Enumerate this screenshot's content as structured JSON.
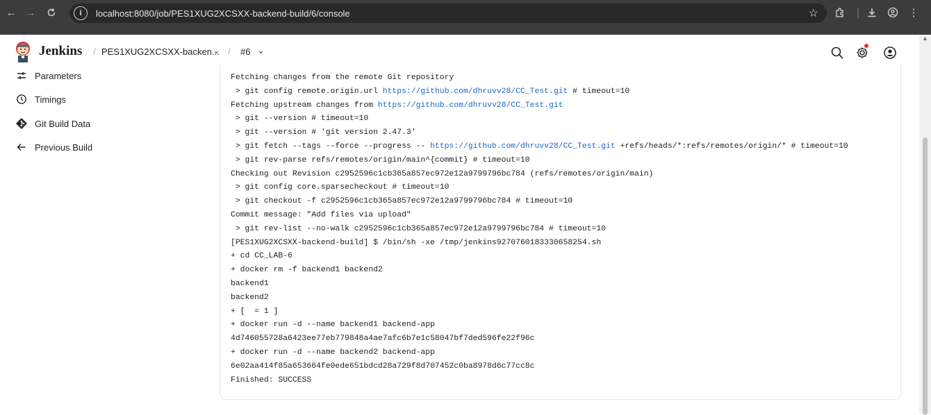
{
  "browser": {
    "url": "localhost:8080/job/PES1XUG2XCSXX-backend-build/6/console"
  },
  "header": {
    "brand": "Jenkins",
    "breadcrumb_job": "PES1XUG2XCSXX-backen...",
    "breadcrumb_build": "#6"
  },
  "sidebar": {
    "items": [
      {
        "label": "Parameters",
        "icon": "sliders-icon"
      },
      {
        "label": "Timings",
        "icon": "clock-icon"
      },
      {
        "label": "Git Build Data",
        "icon": "git-icon"
      },
      {
        "label": "Previous Build",
        "icon": "arrow-left-icon"
      }
    ]
  },
  "console": {
    "lines": [
      {
        "text": "Fetching changes from the remote Git repository"
      },
      {
        "pre": " > git config remote.origin.url ",
        "link": "https://github.com/dhruvv28/CC_Test.git",
        "post": " # timeout=10"
      },
      {
        "pre": "Fetching upstream changes from ",
        "link": "https://github.com/dhruvv28/CC_Test.git",
        "post": ""
      },
      {
        "text": " > git --version # timeout=10"
      },
      {
        "text": " > git --version # 'git version 2.47.3'"
      },
      {
        "pre": " > git fetch --tags --force --progress -- ",
        "link": "https://github.com/dhruvv28/CC_Test.git",
        "post": " +refs/heads/*:refs/remotes/origin/* # timeout=10"
      },
      {
        "text": " > git rev-parse refs/remotes/origin/main^{commit} # timeout=10"
      },
      {
        "text": "Checking out Revision c2952596c1cb365a857ec972e12a9799796bc784 (refs/remotes/origin/main)"
      },
      {
        "text": " > git config core.sparsecheckout # timeout=10"
      },
      {
        "text": " > git checkout -f c2952596c1cb365a857ec972e12a9799796bc784 # timeout=10"
      },
      {
        "text": "Commit message: \"Add files via upload\""
      },
      {
        "text": " > git rev-list --no-walk c2952596c1cb365a857ec972e12a9799796bc784 # timeout=10"
      },
      {
        "text": "[PES1XUG2XCSXX-backend-build] $ /bin/sh -xe /tmp/jenkins9270760183330658254.sh"
      },
      {
        "text": "+ cd CC_LAB-6"
      },
      {
        "text": "+ docker rm -f backend1 backend2"
      },
      {
        "text": "backend1"
      },
      {
        "text": "backend2"
      },
      {
        "text": "+ [  = 1 ]"
      },
      {
        "text": "+ docker run -d --name backend1 backend-app"
      },
      {
        "text": "4d746055728a6423ee77eb779848a4ae7afc6b7e1c58047bf7ded596fe22f96c"
      },
      {
        "text": "+ docker run -d --name backend2 backend-app"
      },
      {
        "text": "6e02aa414f85a653664fe0ede651bdcd28a729f8d707452c0ba8978d6c77cc8c"
      },
      {
        "text": "Finished: SUCCESS"
      }
    ]
  }
}
